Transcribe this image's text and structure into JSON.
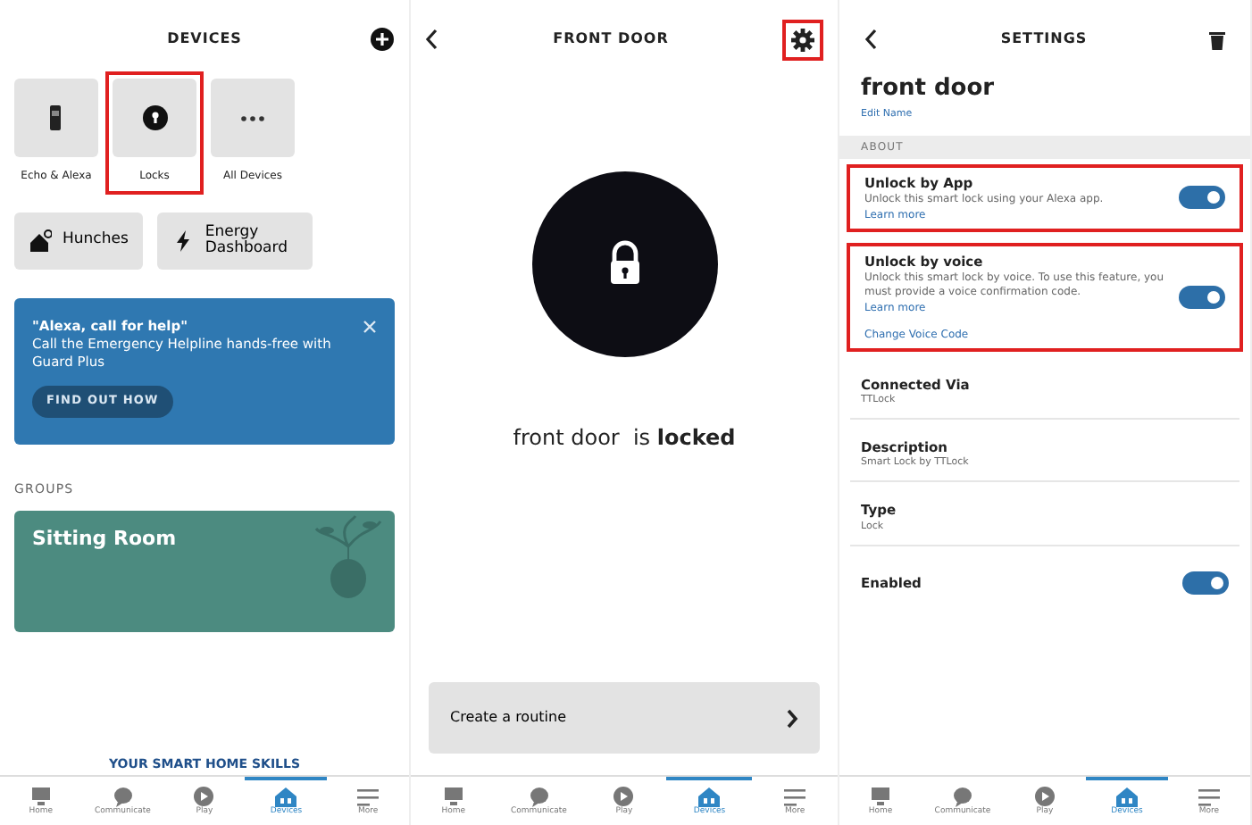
{
  "devices_screen": {
    "title": "DEVICES",
    "tiles": [
      {
        "kind": "echo",
        "label": "Echo & Alexa",
        "highlighted": false
      },
      {
        "kind": "lock",
        "label": "Locks",
        "highlighted": true
      },
      {
        "kind": "more",
        "label": "All Devices",
        "highlighted": false
      }
    ],
    "shortcuts": [
      {
        "kind": "hunches",
        "label": "Hunches"
      },
      {
        "kind": "energy",
        "label": "Energy Dashboard"
      }
    ],
    "banner": {
      "title": "\"Alexa, call for help\"",
      "text": "Call the Emergency Helpline hands-free with Guard Plus",
      "button": "FIND OUT HOW"
    },
    "groups_heading": "GROUPS",
    "group_name": "Sitting Room",
    "skills_link": "YOUR SMART HOME SKILLS",
    "nav": [
      {
        "kind": "home",
        "label": "Home",
        "selected": false
      },
      {
        "kind": "chat",
        "label": "Communicate",
        "selected": false
      },
      {
        "kind": "play",
        "label": "Play",
        "selected": false
      },
      {
        "kind": "devices",
        "label": "Devices",
        "selected": true
      },
      {
        "kind": "more",
        "label": "More",
        "selected": false
      }
    ]
  },
  "lock_screen": {
    "title": "FRONT DOOR",
    "settings_highlighted": true,
    "locked": true,
    "status": "front door  is **locked**",
    "routine": "Create a routine",
    "nav": [
      {
        "kind": "home",
        "label": "Home",
        "selected": false
      },
      {
        "kind": "chat",
        "label": "Communicate",
        "selected": false
      },
      {
        "kind": "play",
        "label": "Play",
        "selected": false
      },
      {
        "kind": "devices",
        "label": "Devices",
        "selected": true
      },
      {
        "kind": "more",
        "label": "More",
        "selected": false
      }
    ]
  },
  "settings_screen": {
    "title": "SETTINGS",
    "device_name": "front door",
    "edit_link": "Edit Name",
    "section": "ABOUT",
    "rows": [
      {
        "kind": "toggle",
        "title": "Unlock by App",
        "text": "Unlock this smart lock using your Alexa app.",
        "links": [
          "Learn more"
        ],
        "on": true,
        "highlighted": true
      },
      {
        "kind": "toggle",
        "title": "Unlock by voice",
        "text": "Unlock this smart lock by voice. To use this feature, you must provide a voice confirmation code.",
        "links": [
          "Learn more",
          "Change Voice Code"
        ],
        "on": true,
        "highlighted": true
      },
      {
        "kind": "info",
        "title": "Connected Via",
        "value": "TTLock"
      },
      {
        "kind": "info",
        "title": "Description",
        "value": "Smart Lock by TTLock"
      },
      {
        "kind": "info",
        "title": "Type",
        "value": "Lock"
      },
      {
        "kind": "toggle",
        "title": "Enabled",
        "on": true,
        "highlighted": false
      }
    ],
    "nav": [
      {
        "kind": "home",
        "label": "Home",
        "selected": false
      },
      {
        "kind": "chat",
        "label": "Communicate",
        "selected": false
      },
      {
        "kind": "play",
        "label": "Play",
        "selected": false
      },
      {
        "kind": "devices",
        "label": "Devices",
        "selected": true
      },
      {
        "kind": "more",
        "label": "More",
        "selected": false
      }
    ]
  }
}
